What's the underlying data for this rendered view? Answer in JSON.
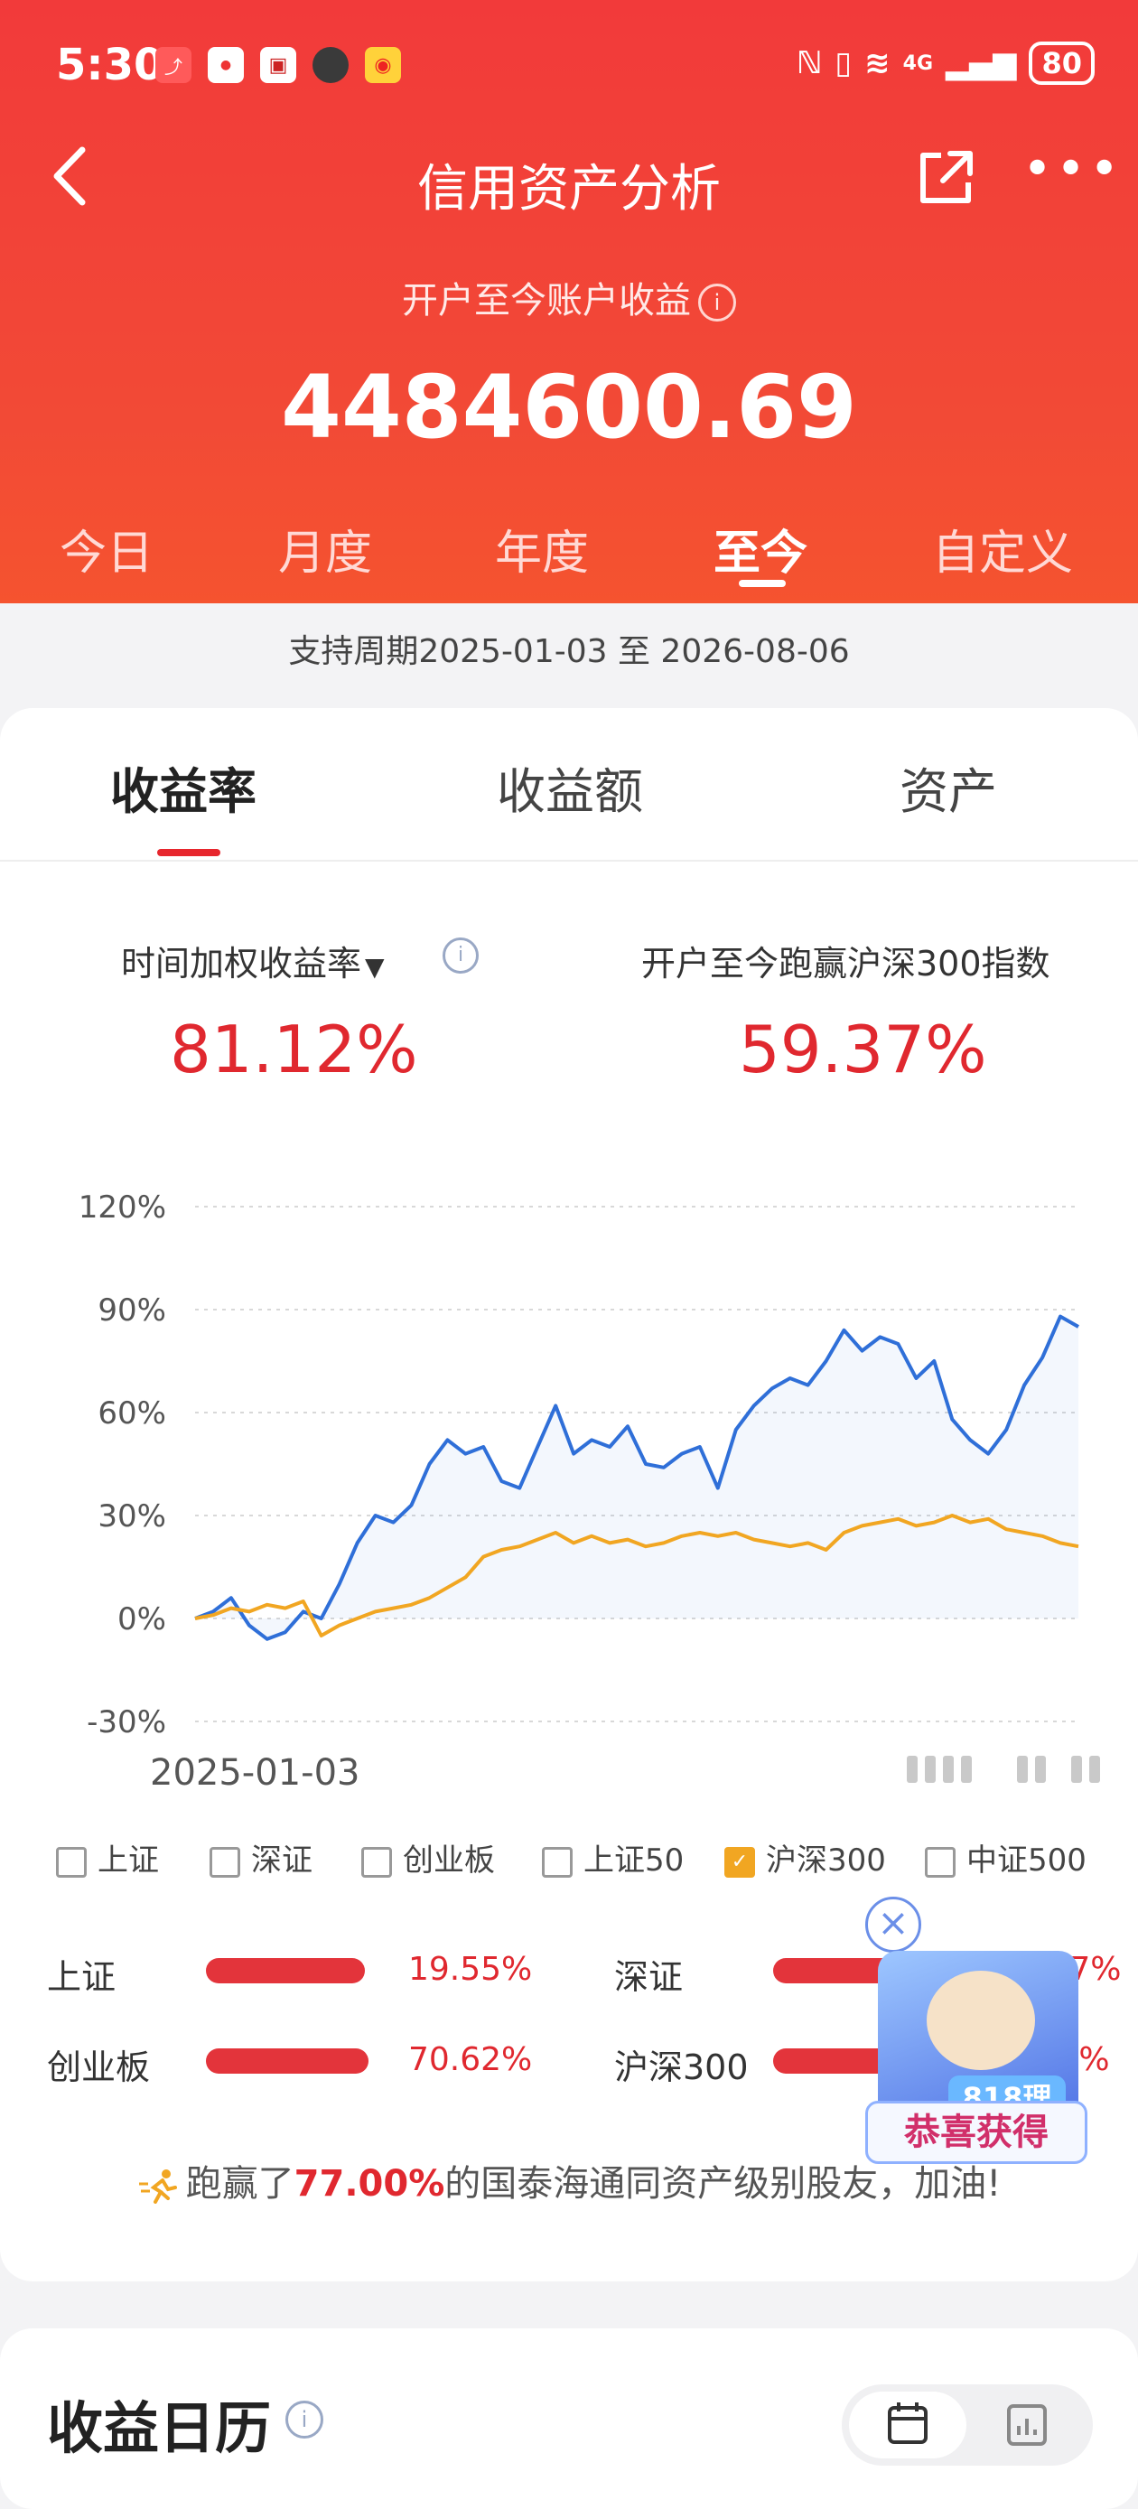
{
  "status_bar": {
    "time": "5:30",
    "notif_icons": [
      "app-icon-stock",
      "app-icon-xiaohongshu",
      "app-icon-shop",
      "app-icon-avatar",
      "app-icon-weibo"
    ],
    "battery": "80",
    "network": "4G"
  },
  "nav": {
    "title": "信用资产分析"
  },
  "summary": {
    "label": "开户至今账户收益",
    "info_glyph": "i",
    "value": "4484600.69"
  },
  "periods": [
    {
      "label": "今日",
      "active": false
    },
    {
      "label": "月度",
      "active": false
    },
    {
      "label": "年度",
      "active": false
    },
    {
      "label": "至今",
      "active": true
    },
    {
      "label": "自定义",
      "active": false
    }
  ],
  "range_text": "支持周期2025-01-03 至 2026-08-06",
  "tabs": [
    {
      "label": "收益率",
      "active": true
    },
    {
      "label": "收益额",
      "active": false
    },
    {
      "label": "资产",
      "active": false
    }
  ],
  "metrics": {
    "left_label": "时间加权收益率",
    "left_value": "81.12%",
    "right_label": "开户至今跑赢沪深300指数",
    "right_value": "59.37%",
    "info_glyph": "i"
  },
  "chart_data": {
    "type": "line",
    "y_ticks": [
      "120%",
      "90%",
      "60%",
      "30%",
      "0%",
      "-30%"
    ],
    "ylim": [
      -30,
      120
    ],
    "x_start_label": "2025-01-03",
    "grid": true,
    "series": [
      {
        "color": "#2f6fd8",
        "values": [
          0,
          2,
          6,
          -2,
          -6,
          -4,
          2,
          0,
          10,
          22,
          30,
          28,
          33,
          45,
          52,
          48,
          50,
          40,
          38,
          50,
          62,
          48,
          52,
          50,
          56,
          45,
          44,
          48,
          50,
          38,
          55,
          62,
          67,
          70,
          68,
          75,
          84,
          78,
          82,
          80,
          70,
          75,
          58,
          52,
          48,
          55,
          68,
          76,
          88,
          85
        ]
      },
      {
        "color": "#f1a622",
        "values": [
          0,
          1,
          3,
          2,
          4,
          3,
          5,
          -5,
          -2,
          0,
          2,
          3,
          4,
          6,
          9,
          12,
          18,
          20,
          21,
          23,
          25,
          22,
          24,
          22,
          23,
          21,
          22,
          24,
          25,
          24,
          25,
          23,
          22,
          21,
          22,
          20,
          25,
          27,
          28,
          29,
          27,
          28,
          30,
          28,
          29,
          26,
          25,
          24,
          22,
          21
        ]
      }
    ]
  },
  "indices": [
    {
      "label": "上证",
      "checked": false
    },
    {
      "label": "深证",
      "checked": false
    },
    {
      "label": "创业板",
      "checked": false
    },
    {
      "label": "上证50",
      "checked": false
    },
    {
      "label": "沪深300",
      "checked": true
    },
    {
      "label": "中证500",
      "checked": false
    }
  ],
  "bars": [
    {
      "label": "上证",
      "value": "19.55%",
      "fill": 0.98
    },
    {
      "label": "深证",
      "value": ".87%",
      "fill": 0.95
    },
    {
      "label": "创业板",
      "value": "70.62%",
      "fill": 1.0
    },
    {
      "label": "沪深300",
      "value": ".5%",
      "fill": 0.95
    }
  ],
  "promo": {
    "close_glyph": "×",
    "badge": "818理财节",
    "button": "恭喜获得"
  },
  "beat": {
    "prefix": "跑赢了",
    "pct": "77.00%",
    "suffix": "的国泰海通同资产级别股友，加油!"
  },
  "calendar": {
    "title": "收益日历",
    "info_glyph": "i"
  }
}
